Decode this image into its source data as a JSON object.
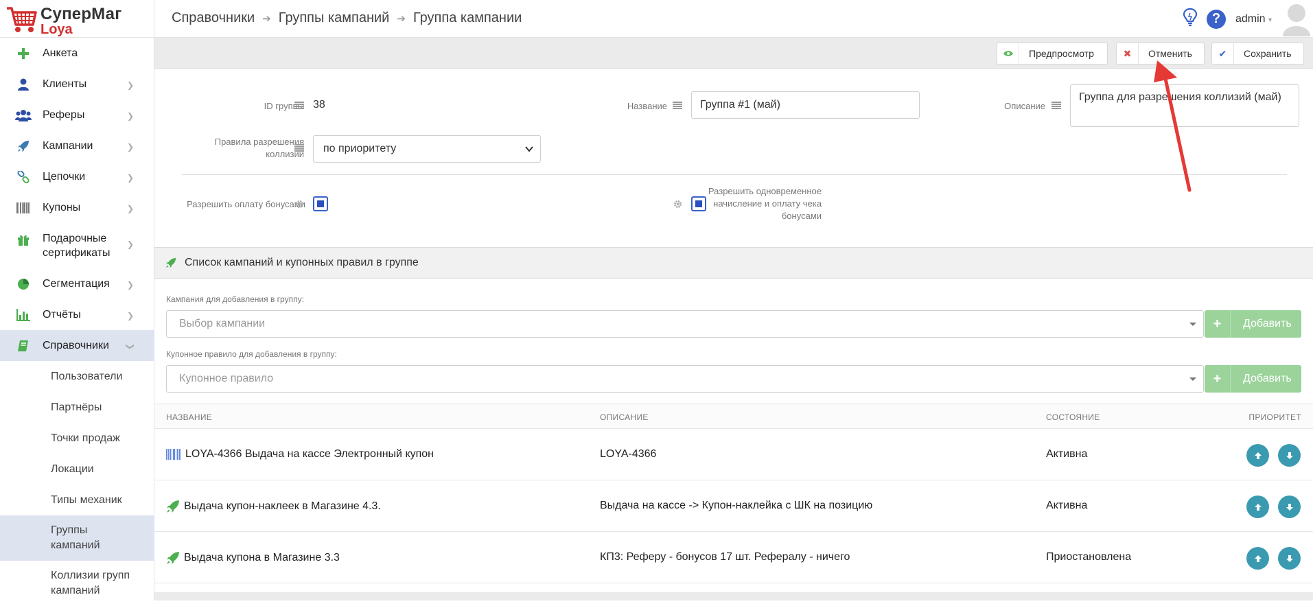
{
  "app": {
    "brand_line1": "СуперМаг",
    "brand_line2": "Loya"
  },
  "sidebar": {
    "items": [
      {
        "label": "Анкета",
        "icon": "plus-icon"
      },
      {
        "label": "Клиенты",
        "icon": "user-icon"
      },
      {
        "label": "Реферы",
        "icon": "users-icon"
      },
      {
        "label": "Кампании",
        "icon": "rocket-icon"
      },
      {
        "label": "Цепочки",
        "icon": "chain-icon"
      },
      {
        "label": "Купоны",
        "icon": "barcode-icon"
      },
      {
        "label": "Подарочные сертификаты",
        "icon": "gift-icon"
      },
      {
        "label": "Сегментация",
        "icon": "pie-chart-icon"
      },
      {
        "label": "Отчёты",
        "icon": "bar-chart-icon"
      },
      {
        "label": "Справочники",
        "icon": "book-icon"
      }
    ],
    "subitems": [
      {
        "label": "Пользователи"
      },
      {
        "label": "Партнёры"
      },
      {
        "label": "Точки продаж"
      },
      {
        "label": "Локации"
      },
      {
        "label": "Типы механик"
      },
      {
        "label": "Группы кампаний"
      },
      {
        "label": "Коллизии групп кампаний"
      }
    ]
  },
  "header": {
    "breadcrumbs": [
      "Справочники",
      "Группы кампаний",
      "Группа кампании"
    ],
    "username": "admin"
  },
  "toolbar": {
    "preview_label": "Предпросмотр",
    "cancel_label": "Отменить",
    "save_label": "Сохранить"
  },
  "form": {
    "id_label": "ID группы",
    "id_value": "38",
    "name_label": "Название",
    "name_value": "Группа #1 (май)",
    "desc_label": "Описание",
    "desc_value": "Группа для разрешения коллизий (май)",
    "rules_label_1": "Правила разрешения",
    "rules_label_2": "коллизий",
    "rules_value": "по приоритету",
    "allow_bonus_label": "Разрешить оплату бонусами",
    "allow_bonus_checked": true,
    "simul_label_1": "Разрешить одновременное",
    "simul_label_2": "начисление и оплату чека",
    "simul_label_3": "бонусами",
    "simul_checked": true
  },
  "section": {
    "title": "Список кампаний и купонных правил в группе",
    "campaign_label": "Кампания для добавления в группу:",
    "campaign_placeholder": "Выбор кампании",
    "coupon_label": "Купонное правило для добавления в группу:",
    "coupon_placeholder": "Купонное правило",
    "add_label": "Добавить"
  },
  "table": {
    "headers": {
      "name": "НАЗВАНИЕ",
      "desc": "ОПИСАНИЕ",
      "state": "СОСТОЯНИЕ",
      "priority": "ПРИОРИТЕТ"
    },
    "rows": [
      {
        "icon": "barcode-icon",
        "name": "LOYA-4366 Выдача на кассе Электронный купон",
        "desc": "LOYA-4366",
        "state": "Активна"
      },
      {
        "icon": "rocket-icon",
        "name": "Выдача купон-наклеек в Магазине 4.3.",
        "desc": "Выдача на кассе -> Купон-наклейка с ШК на позицию",
        "state": "Активна"
      },
      {
        "icon": "rocket-icon",
        "name": "Выдача купона в Магазине 3.3",
        "desc": "КП3: Реферу - бонусов 17 шт. Рефералу - ничего",
        "state": "Приостановлена"
      }
    ]
  },
  "colors": {
    "accent": "#3a62c9",
    "green": "#5cb85c",
    "teal": "#3a9ab0",
    "brand_red": "#d32f2f",
    "active_bg": "#dde3ef"
  }
}
